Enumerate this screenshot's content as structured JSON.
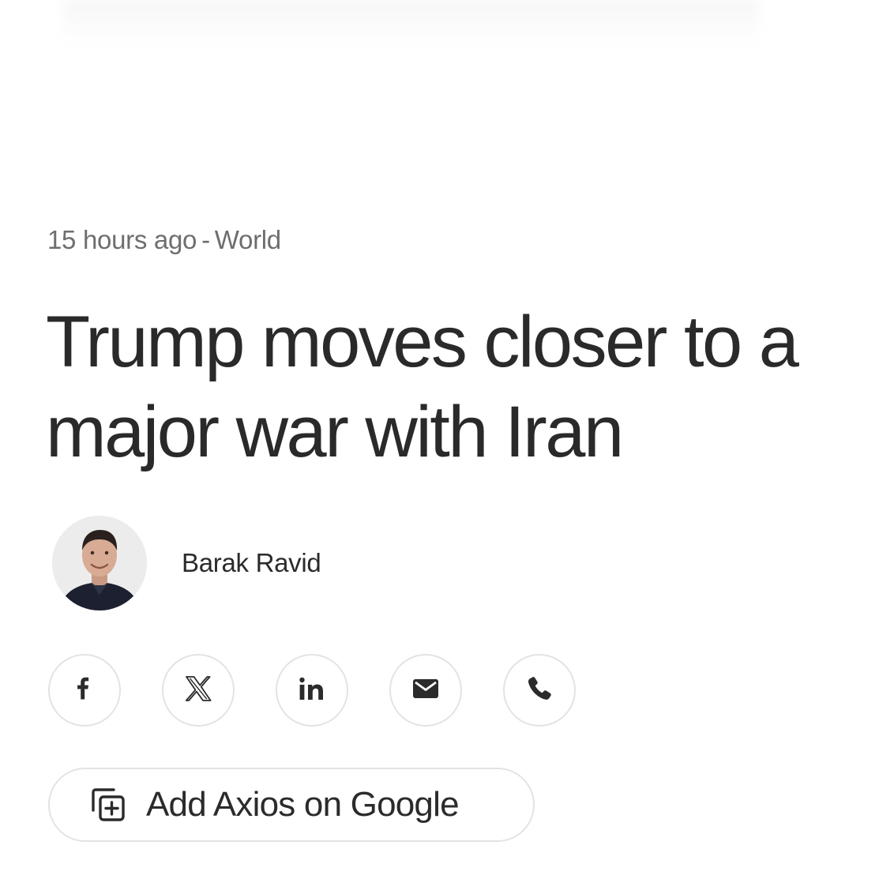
{
  "article": {
    "timestamp": "15 hours ago",
    "separator": "-",
    "section": "World",
    "headline": "Trump moves closer to a major war with Iran",
    "author": "Barak Ravid"
  },
  "share": {
    "buttons": [
      {
        "icon": "facebook-icon"
      },
      {
        "icon": "x-icon"
      },
      {
        "icon": "linkedin-icon"
      },
      {
        "icon": "email-icon"
      },
      {
        "icon": "phone-icon"
      }
    ]
  },
  "google_follow": {
    "label": "Add Axios on Google",
    "icon": "add-source-icon"
  },
  "colors": {
    "text": "#2b2b2b",
    "meta": "#6e6e6e",
    "border": "#e3e3e3"
  }
}
